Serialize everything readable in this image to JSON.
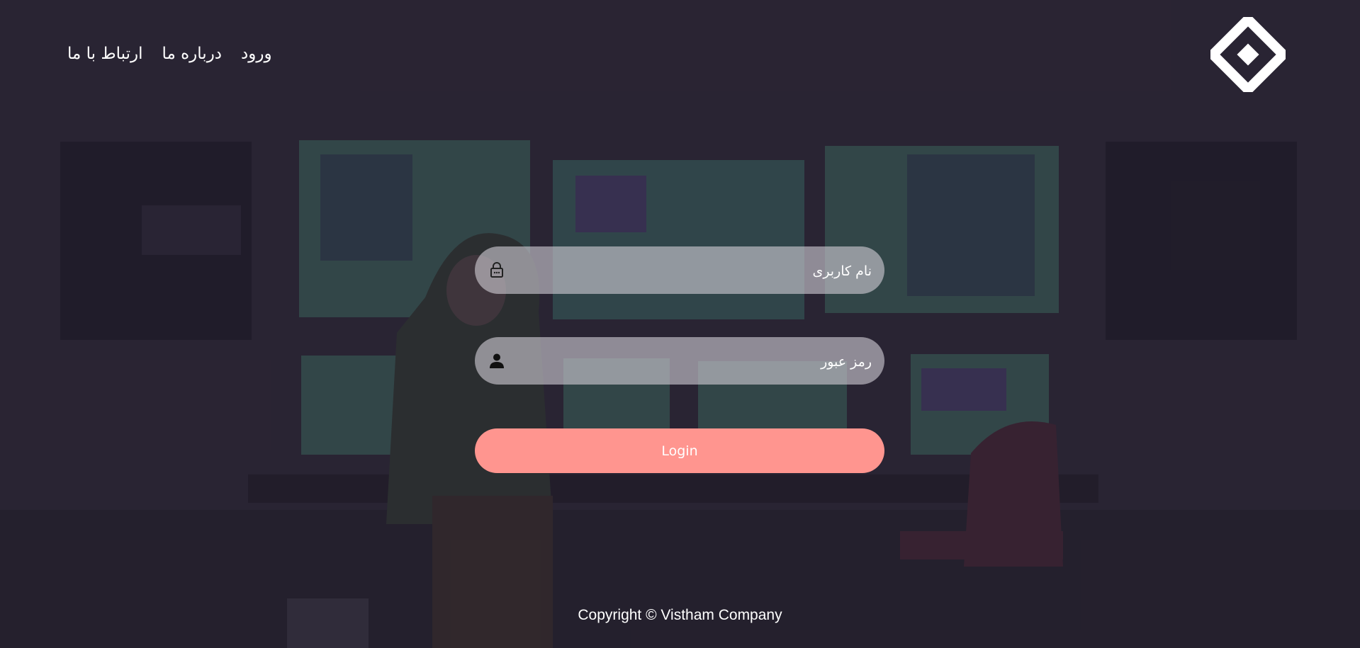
{
  "header": {
    "nav": [
      {
        "label": "ارتباط با ما"
      },
      {
        "label": "درباره ما"
      },
      {
        "label": "ورود"
      }
    ],
    "logo_icon": "diamond-logo-icon"
  },
  "form": {
    "username_placeholder": "نام کاربری",
    "username_icon": "lock-icon",
    "password_placeholder": "رمز عبور",
    "password_icon": "user-icon",
    "login_label": "Login"
  },
  "footer": {
    "copyright": "Copyright © Vistham Company"
  },
  "colors": {
    "accent": "#ff958f",
    "input_background": "#cecdd4",
    "text": "#ffffff",
    "background": "#2a2630"
  }
}
